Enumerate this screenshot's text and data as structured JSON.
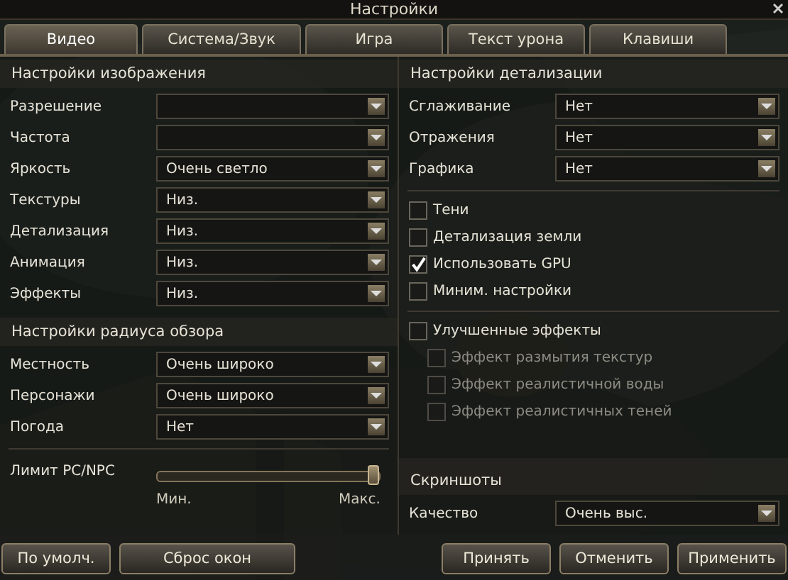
{
  "window": {
    "title": "Настройки"
  },
  "tabs": [
    {
      "label": "Видео",
      "selected": true
    },
    {
      "label": "Система/Звук",
      "selected": false
    },
    {
      "label": "Игра",
      "selected": false
    },
    {
      "label": "Текст урона",
      "selected": false
    },
    {
      "label": "Клавиши",
      "selected": false
    }
  ],
  "image_settings": {
    "title": "Настройки изображения",
    "rows": [
      {
        "label": "Разрешение",
        "value": ""
      },
      {
        "label": "Частота",
        "value": ""
      },
      {
        "label": "Яркость",
        "value": "Очень светло"
      },
      {
        "label": "Текстуры",
        "value": "Низ."
      },
      {
        "label": "Детализация",
        "value": "Низ."
      },
      {
        "label": "Анимация",
        "value": "Низ."
      },
      {
        "label": "Эффекты",
        "value": "Низ."
      }
    ]
  },
  "view_radius": {
    "title": "Настройки радиуса обзора",
    "rows": [
      {
        "label": "Местность",
        "value": "Очень широко"
      },
      {
        "label": "Персонажи",
        "value": "Очень широко"
      },
      {
        "label": "Погода",
        "value": "Нет"
      }
    ],
    "slider": {
      "label": "Лимит PC/NPC",
      "level": 1,
      "min_label": "Мин.",
      "max_label": "Макс."
    }
  },
  "detail_settings": {
    "title": "Настройки детализации",
    "rows": [
      {
        "label": "Сглаживание",
        "value": "Нет"
      },
      {
        "label": "Отражения",
        "value": "Нет"
      },
      {
        "label": "Графика",
        "value": "Нет"
      }
    ],
    "checks": [
      {
        "label": "Тени",
        "checked": false
      },
      {
        "label": "Детализация земли",
        "checked": false
      },
      {
        "label": "Использовать GPU",
        "checked": true
      },
      {
        "label": "Миним. настройки",
        "checked": false
      }
    ],
    "effects": {
      "label": "Улучшенные эффекты",
      "checked": false,
      "children": [
        {
          "label": "Эффект размытия текстур",
          "checked": false,
          "disabled": true
        },
        {
          "label": "Эффект реалистичной воды",
          "checked": false,
          "disabled": true
        },
        {
          "label": "Эффект реалистичных теней",
          "checked": false,
          "disabled": true
        }
      ]
    }
  },
  "screenshots": {
    "title": "Скриншоты",
    "rows": [
      {
        "label": "Качество",
        "value": "Очень выс."
      }
    ]
  },
  "buttons_left": [
    "По умолч.",
    "Сброс окон"
  ],
  "buttons_right": [
    "Принять",
    "Отменить",
    "Применить"
  ]
}
